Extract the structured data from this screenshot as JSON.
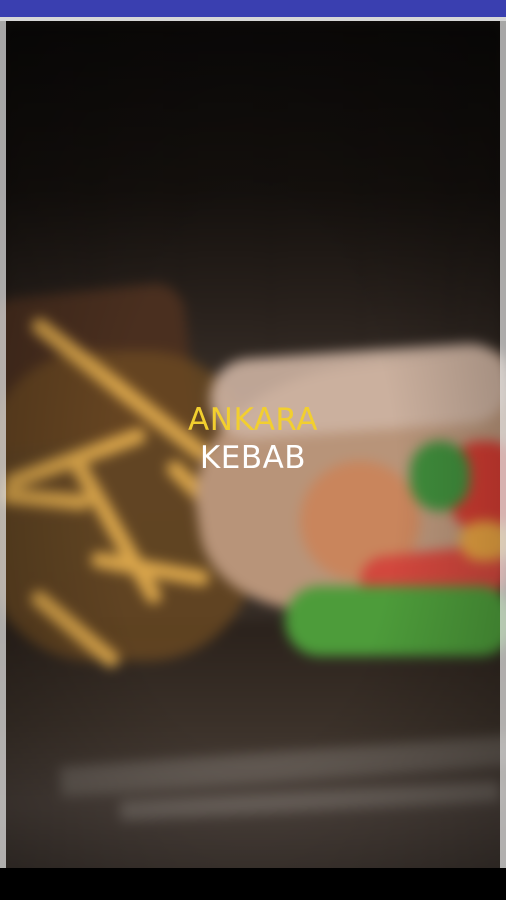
{
  "app": {
    "title_line1": "ANKARA",
    "title_line2": "KEBAB"
  },
  "colors": {
    "status_bar": "#3a3fb0",
    "title_line1": "#f2cf2f",
    "title_line2": "#ffffff",
    "nav_bar": "#000000"
  },
  "background_image": "blurred-kebab-wrap-and-fries-photo"
}
